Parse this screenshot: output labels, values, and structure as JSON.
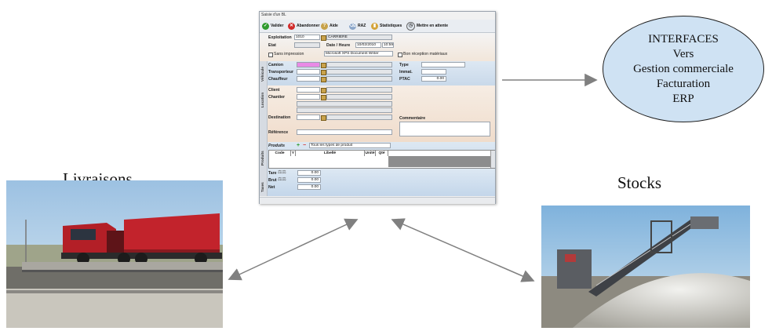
{
  "labels": {
    "deliveries": "Livraisons",
    "stocks": "Stocks"
  },
  "interfaces": {
    "lines": [
      "INTERFACES",
      "Vers",
      "Gestion commerciale",
      "Facturation",
      "ERP"
    ]
  },
  "app": {
    "window_title": "Saisie d'un BL",
    "toolbar": [
      {
        "label": "Valider",
        "icon": "check-icon"
      },
      {
        "label": "Abandonner",
        "icon": "cancel-icon"
      },
      {
        "label": "Aide",
        "icon": "help-icon"
      },
      {
        "label": "RAZ",
        "icon": "eraser-icon"
      },
      {
        "label": "Statistiques",
        "icon": "stats-icon"
      },
      {
        "label": "Mettre en attente",
        "icon": "clock-icon"
      }
    ],
    "header": {
      "exploitation_label": "Exploitation",
      "exploitation_code": "1010",
      "exploitation_name": "CARRIERE",
      "etat_label": "Etat",
      "date_label": "Date / Heure",
      "date_value": "10/02/2010",
      "time_value": "10:59",
      "sans_impression_label": "Sans impression",
      "printer_value": "Microsoft XPS Document Writer",
      "bon_reception_label": "Bon réception matériaux"
    },
    "vehicle": {
      "side_label": "Véhicule",
      "camion_label": "Camion",
      "transporteur_label": "Transporteur",
      "chauffeur_label": "Chauffeur",
      "type_label": "Type",
      "immat_label": "Immat.",
      "ptac_label": "PTAC",
      "ptac_value": "0.00"
    },
    "location": {
      "side_label": "Location",
      "client_label": "Client",
      "chantier_label": "Chantier",
      "destination_label": "Destination",
      "reference_label": "Référence",
      "commentaire_label": "Commentaire"
    },
    "products": {
      "side_label": "Produits",
      "produits_label": "Produits",
      "filter_value": "Tous les types de produit",
      "columns": [
        "Code",
        "Y",
        "Libellé",
        "Unité",
        "Qté"
      ]
    },
    "weights": {
      "side_label": "Taxes",
      "tare_label": "Tare",
      "brut_label": "Brut",
      "net_label": "Net",
      "tare_value": "0.00",
      "brut_value": "0.00",
      "net_value": "0.00"
    }
  },
  "colors": {
    "ellipse_fill": "#cfe2f3",
    "arrow_gray": "#808080"
  }
}
